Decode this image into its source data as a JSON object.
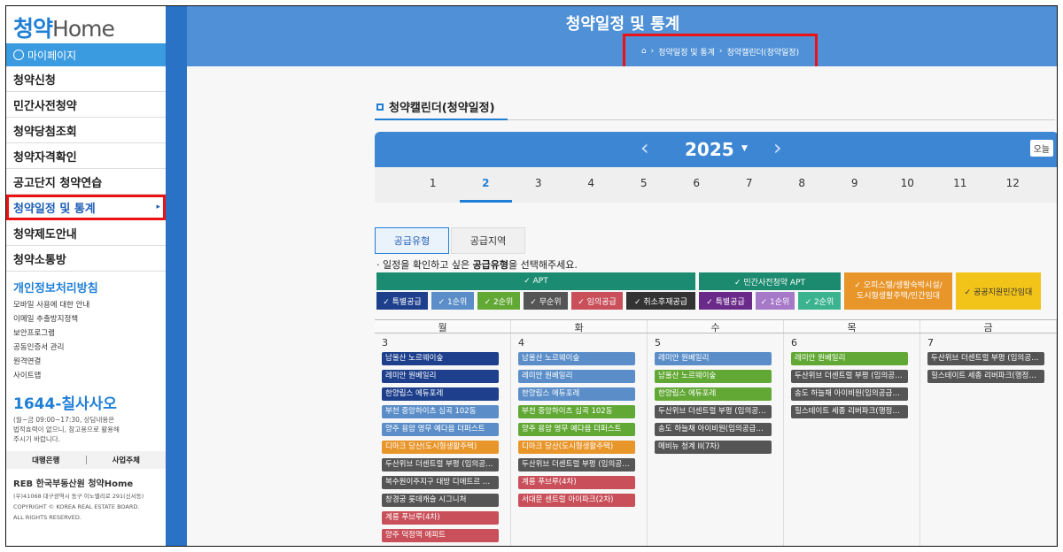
{
  "sidebar": {
    "logo_k": "청약",
    "logo_en": "Home",
    "mypage": "마이페이지",
    "menu": [
      "청약신청",
      "민간사전청약",
      "청약당첨조회",
      "청약자격확인",
      "공고단지 청약연습",
      "청약일정 및 통계",
      "청약제도안내",
      "청약소통방"
    ],
    "privacy": "개인정보처리방침",
    "links": [
      "모바일 사용에 대한 안내",
      "이메일 추출방지정책",
      "보안프로그램",
      "공동인증서 관리",
      "원격연결",
      "사이트맵"
    ],
    "phone": "1644-칠사사오",
    "phone_note1": "(월~금 09:00~17:30, 상담내용은",
    "phone_note2": "법적효력이 없으니, 참고용으로 활용해",
    "phone_note3": "주시기 바랍니다.",
    "bank": "대행은행",
    "biz": "사업주체",
    "footer_logo": "REB 한국부동산원 청약Home",
    "footer1": "(우)41068 대구광역시 동구 이노밸리로 291(신서동)",
    "footer2": "COPYRIGHT © KOREA REAL ESTATE BOARD.",
    "footer3": "ALL RIGHTS RESERVED."
  },
  "header": {
    "title": "청약일정 및 통계",
    "crumb1": "청약일정 및 통계",
    "crumb2": "청약캘린더(청약일정)"
  },
  "calendar": {
    "title": "청약캘린더(청약일정)",
    "year": "2025",
    "today": "오늘",
    "months": [
      "1",
      "2",
      "3",
      "4",
      "5",
      "6",
      "7",
      "8",
      "9",
      "10",
      "11",
      "12"
    ],
    "current_month": "2",
    "tab1": "공급유형",
    "tab2": "공급지역",
    "hint_pre": "· 일정을 확인하고 싶은 ",
    "hint_bold": "공급유형",
    "hint_post": "을 선택해주세요.",
    "legend_apt": "✓ APT",
    "legend_pre": "✓ 민간사전청약 APT",
    "legend_office": "✓ 오피스텔/생활숙박시설/",
    "legend_office2": "도시형생활주택/민간임대",
    "legend_public": "✓ 공공지원민간임대",
    "apt_sub": [
      "✓ 특별공급",
      "✓ 1순위",
      "✓ 2순위",
      "✓ 무순위",
      "✓ 임의공급",
      "✓ 취소후재공급"
    ],
    "pre_sub": [
      "✓ 특별공급",
      "✓ 1순위",
      "✓ 2순위"
    ],
    "weekdays": [
      "월",
      "화",
      "수",
      "목",
      "금"
    ],
    "days": [
      "3",
      "4",
      "5",
      "6",
      "7"
    ],
    "events": [
      [
        [
          "남울산 노르웨이숲",
          "c-navy"
        ],
        [
          "레미안 원베일리",
          "c-navy"
        ],
        [
          "한양립스 에듀포레",
          "c-navy"
        ],
        [
          "부천 중앙하이츠 심곡 102동",
          "c-blue"
        ],
        [
          "양주 용암 영무 예다음 더퍼스트",
          "c-blue"
        ],
        [
          "디마크 당산(도시형생활주택)",
          "c-orange"
        ],
        [
          "두산위브 더센트럴 부평 (임의공…",
          "c-dark"
        ],
        [
          "복수원이주지구 대방 디에트르 …",
          "c-dark"
        ],
        [
          "창경궁 롯데캐슬 시그니처",
          "c-dark"
        ],
        [
          "계룡 푸브루(4차)",
          "c-red"
        ],
        [
          "양주 덕정역 에피트",
          "c-red"
        ]
      ],
      [
        [
          "남울산 노르웨이숲",
          "c-blue"
        ],
        [
          "레미안 원베일리",
          "c-blue"
        ],
        [
          "한양립스 에듀포레",
          "c-blue"
        ],
        [
          "부천 중앙하이츠 심곡 102동",
          "c-green"
        ],
        [
          "양주 용암 영무 예다음 더퍼스트",
          "c-green"
        ],
        [
          "디마크 당산(도시형생활주택)",
          "c-orange"
        ],
        [
          "두산위브 더센트럴 부평 (임의공…",
          "c-dark"
        ],
        [
          "계룡 푸브루(4차)",
          "c-red"
        ],
        [
          "서대문 센트럴 아이파크(2차)",
          "c-red"
        ]
      ],
      [
        [
          "레미안 원베일리",
          "c-blue"
        ],
        [
          "남울산 노르웨이숲",
          "c-green"
        ],
        [
          "한양립스 에듀포레",
          "c-green"
        ],
        [
          "두산위브 더센트럴 부평 (임의공…",
          "c-dark"
        ],
        [
          "송도 하늘채 아이비원(임의공급…",
          "c-dark"
        ],
        [
          "메비뉴 청계 II(7차)",
          "c-dark"
        ]
      ],
      [
        [
          "레미안 원베일리",
          "c-green"
        ],
        [
          "두산위브 더센트럴 부평 (임의공…",
          "c-dark"
        ],
        [
          "송도 하늘채 아이비원(임의공급…",
          "c-dark"
        ],
        [
          "힐스테이트 세종 리버파크(행정…",
          "c-dark"
        ]
      ],
      [
        [
          "두산위브 더센트럴 부평 (임의공…",
          "c-dark"
        ],
        [
          "힐스테이트 세종 리버파크(행정…",
          "c-dark"
        ]
      ]
    ]
  }
}
